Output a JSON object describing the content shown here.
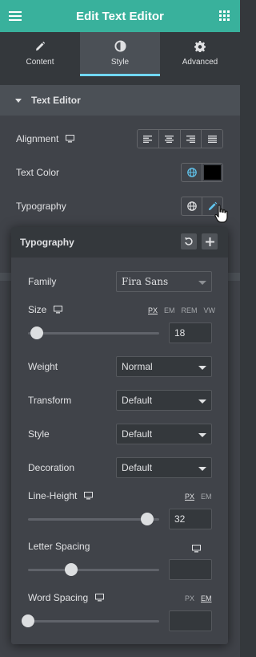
{
  "header": {
    "title": "Edit Text Editor",
    "menu_icon": "hamburger-menu-icon",
    "apps_icon": "grid-apps-icon"
  },
  "tabs": [
    {
      "label": "Content",
      "icon": "pencil-icon",
      "active": false
    },
    {
      "label": "Style",
      "icon": "half-circle-contrast-icon",
      "active": true
    },
    {
      "label": "Advanced",
      "icon": "gear-icon",
      "active": false
    }
  ],
  "section": {
    "title": "Text Editor"
  },
  "controls": {
    "alignment": {
      "label": "Alignment",
      "options": [
        "left",
        "center",
        "right",
        "justify"
      ]
    },
    "text_color": {
      "label": "Text Color",
      "value": "#000000"
    },
    "typography": {
      "label": "Typography"
    }
  },
  "popover": {
    "title": "Typography",
    "family": {
      "label": "Family",
      "value": "Fira Sans"
    },
    "size": {
      "label": "Size",
      "units": [
        "PX",
        "EM",
        "REM",
        "VW"
      ],
      "active_unit": "PX",
      "value": "18",
      "slider_fraction": 0.07
    },
    "weight": {
      "label": "Weight",
      "value": "Normal"
    },
    "transform": {
      "label": "Transform",
      "value": "Default"
    },
    "style": {
      "label": "Style",
      "value": "Default"
    },
    "decoration": {
      "label": "Decoration",
      "value": "Default"
    },
    "line_height": {
      "label": "Line-Height",
      "units": [
        "PX",
        "EM"
      ],
      "active_unit": "PX",
      "value": "32",
      "slider_fraction": 0.91
    },
    "letter_spacing": {
      "label": "Letter Spacing",
      "value": "",
      "slider_fraction": 0.33
    },
    "word_spacing": {
      "label": "Word Spacing",
      "units": [
        "PX",
        "EM"
      ],
      "active_unit": "EM",
      "value": "",
      "slider_fraction": 0.0
    }
  },
  "colors": {
    "brand": "#39b19c",
    "active_tab_underline": "#71d7f7",
    "panel": "#404349",
    "dark": "#34383c"
  }
}
